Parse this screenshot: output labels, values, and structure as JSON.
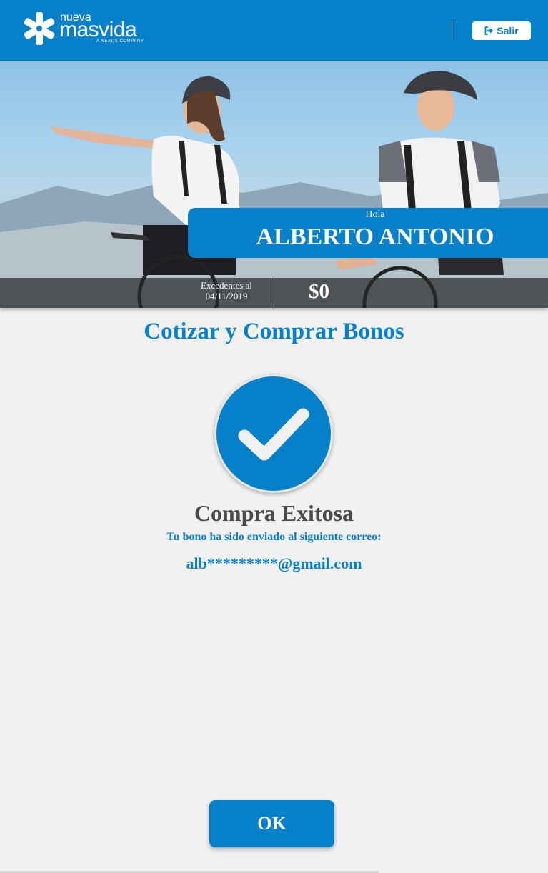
{
  "colors": {
    "brand": "#0680c8",
    "background": "#f1f1f1",
    "heading_gray": "#4a4a4a"
  },
  "header": {
    "logo": {
      "line1": "nueva",
      "line2": "masvida",
      "tagline": "A NEXUS COMPANY"
    },
    "logout_label": "Salir",
    "logout_icon": "sign-out-icon"
  },
  "banner": {
    "greeting": "Hola",
    "user_name": "ALBERTO ANTONIO",
    "excess_label_line1": "Excedentes al",
    "excess_date": "04/11/2019",
    "excess_amount": "$0"
  },
  "main": {
    "title": "Cotizar y Comprar Bonos",
    "success_icon": "checkmark-icon",
    "success_title": "Compra Exitosa",
    "success_message": "Tu bono ha sido enviado al siguiente correo:",
    "email": "alb*********@gmail.com",
    "ok_label": "OK"
  }
}
